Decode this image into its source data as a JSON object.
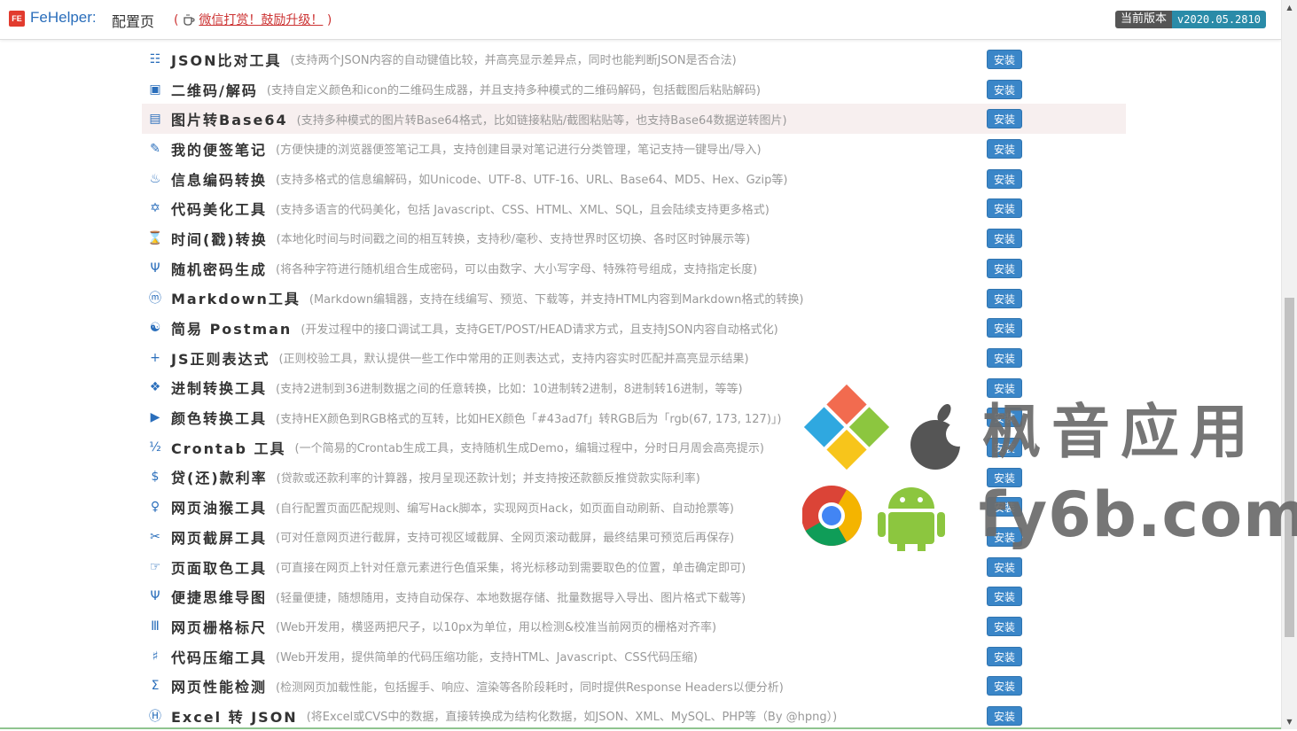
{
  "header": {
    "logo_text": "FE",
    "app_name": "FeHelper:",
    "page_title": "配置页",
    "donate_open": "(",
    "donate_link": "微信打赏！鼓励升级！",
    "donate_close": ")",
    "version_label": "当前版本",
    "version_value": "v2020.05.2810"
  },
  "tools": [
    {
      "icon": "☷",
      "name": "JSON比对工具",
      "desc": "(支持两个JSON内容的自动键值比较，并高亮显示差异点，同时也能判断JSON是否合法)",
      "button": "安装"
    },
    {
      "icon": "▣",
      "name": "二维码/解码",
      "desc": "(支持自定义颜色和icon的二维码生成器，并且支持多种模式的二维码解码，包括截图后粘贴解码)",
      "button": "安装"
    },
    {
      "icon": "▤",
      "name": "图片转Base64",
      "desc": "(支持多种模式的图片转Base64格式，比如链接粘贴/截图粘贴等，也支持Base64数据逆转图片)",
      "button": "安装"
    },
    {
      "icon": "✎",
      "name": "我的便签笔记",
      "desc": "(方便快捷的浏览器便签笔记工具，支持创建目录对笔记进行分类管理，笔记支持一键导出/导入)",
      "button": "安装"
    },
    {
      "icon": "♨",
      "name": "信息编码转换",
      "desc": "(支持多格式的信息编解码，如Unicode、UTF-8、UTF-16、URL、Base64、MD5、Hex、Gzip等)",
      "button": "安装"
    },
    {
      "icon": "✡",
      "name": "代码美化工具",
      "desc": "(支持多语言的代码美化，包括 Javascript、CSS、HTML、XML、SQL，且会陆续支持更多格式)",
      "button": "安装"
    },
    {
      "icon": "⌛",
      "name": "时间(戳)转换",
      "desc": "(本地化时间与时间戳之间的相互转换，支持秒/毫秒、支持世界时区切换、各时区时钟展示等)",
      "button": "安装"
    },
    {
      "icon": "Ψ",
      "name": "随机密码生成",
      "desc": "(将各种字符进行随机组合生成密码，可以由数字、大小写字母、特殊符号组成，支持指定长度)",
      "button": "安装"
    },
    {
      "icon": "ⓜ",
      "name": "Markdown工具",
      "desc": "(Markdown编辑器，支持在线编写、预览、下载等，并支持HTML内容到Markdown格式的转换)",
      "button": "安装"
    },
    {
      "icon": "☯",
      "name": "简易 Postman",
      "desc": "(开发过程中的接口调试工具，支持GET/POST/HEAD请求方式，且支持JSON内容自动格式化)",
      "button": "安装"
    },
    {
      "icon": "+",
      "name": "JS正则表达式",
      "desc": "(正则校验工具，默认提供一些工作中常用的正则表达式，支持内容实时匹配并高亮显示结果)",
      "button": "安装"
    },
    {
      "icon": "❖",
      "name": "进制转换工具",
      "desc": "(支持2进制到36进制数据之间的任意转换，比如：10进制转2进制，8进制转16进制，等等)",
      "button": "安装"
    },
    {
      "icon": "▶",
      "name": "颜色转换工具",
      "desc": "(支持HEX颜色到RGB格式的互转，比如HEX颜色「#43ad7f」转RGB后为「rgb(67, 173, 127)」)",
      "button": "安装"
    },
    {
      "icon": "½",
      "name": "Crontab 工具",
      "desc": "(一个简易的Crontab生成工具，支持随机生成Demo，编辑过程中，分时日月周会高亮提示)",
      "button": "安装"
    },
    {
      "icon": "$",
      "name": "贷(还)款利率",
      "desc": "(贷款或还款利率的计算器，按月呈现还款计划；并支持按还款额反推贷款实际利率)",
      "button": "安装"
    },
    {
      "icon": "♀",
      "name": "网页油猴工具",
      "desc": "(自行配置页面匹配规则、编写Hack脚本，实现网页Hack，如页面自动刷新、自动抢票等)",
      "button": "安装"
    },
    {
      "icon": "✂",
      "name": "网页截屏工具",
      "desc": "(可对任意网页进行截屏，支持可视区域截屏、全网页滚动截屏，最终结果可预览后再保存)",
      "button": "安装"
    },
    {
      "icon": "☞",
      "name": "页面取色工具",
      "desc": "(可直接在网页上针对任意元素进行色值采集，将光标移动到需要取色的位置，单击确定即可)",
      "button": "安装"
    },
    {
      "icon": "Ψ",
      "name": "便捷思维导图",
      "desc": "(轻量便捷，随想随用，支持自动保存、本地数据存储、批量数据导入导出、图片格式下载等)",
      "button": "安装"
    },
    {
      "icon": "Ⅲ",
      "name": "网页栅格标尺",
      "desc": "(Web开发用，横竖两把尺子，以10px为单位，用以检测&校准当前网页的栅格对齐率)",
      "button": "安装"
    },
    {
      "icon": "♯",
      "name": "代码压缩工具",
      "desc": "(Web开发用，提供简单的代码压缩功能，支持HTML、Javascript、CSS代码压缩)",
      "button": "安装"
    },
    {
      "icon": "Σ",
      "name": "网页性能检测",
      "desc": "(检测网页加载性能，包括握手、响应、渲染等各阶段耗时，同时提供Response Headers以便分析)",
      "button": "安装"
    },
    {
      "icon": "Ⓗ",
      "name": "Excel 转 JSON",
      "desc": "(将Excel或CVS中的数据，直接转换成为结构化数据，如JSON、XML、MySQL、PHP等（By @hpng）)",
      "button": "安装"
    }
  ],
  "watermark": {
    "line1": "枫音应用",
    "line2": "fy6b.com"
  }
}
